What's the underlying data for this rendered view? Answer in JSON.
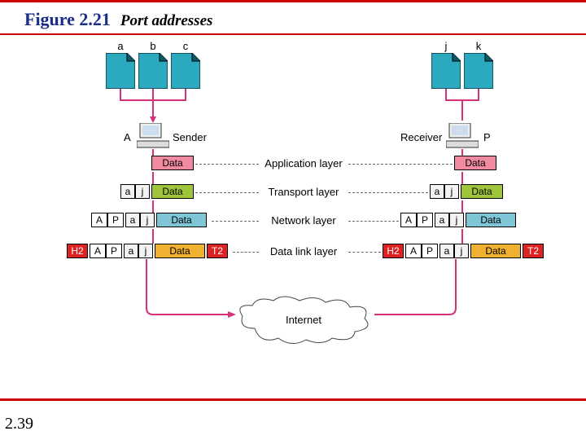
{
  "figure": {
    "number": "Figure 2.21",
    "title": "Port addresses"
  },
  "page_number": "2.39",
  "processes": {
    "sender": [
      "a",
      "b",
      "c"
    ],
    "receiver": [
      "j",
      "k"
    ]
  },
  "hosts": {
    "sender": {
      "label": "A",
      "role": "Sender"
    },
    "receiver": {
      "label": "P",
      "role": "Receiver"
    }
  },
  "layers": [
    "Application layer",
    "Transport layer",
    "Network layer",
    "Data link layer"
  ],
  "headers": {
    "A": "A",
    "P": "P",
    "a": "a",
    "j": "j",
    "H2": "H2",
    "Data": "Data",
    "T2": "T2"
  },
  "cloud": "Internet",
  "colors": {
    "doc_fill": "#2aa9bf",
    "data_app": "#f08aa1",
    "data_transport": "#9fc63a",
    "data_network": "#7ec6d6",
    "data_link": "#f0b030",
    "H2": "#d22",
    "T2": "#d22",
    "hdr_bg": "#f2f2f2"
  }
}
